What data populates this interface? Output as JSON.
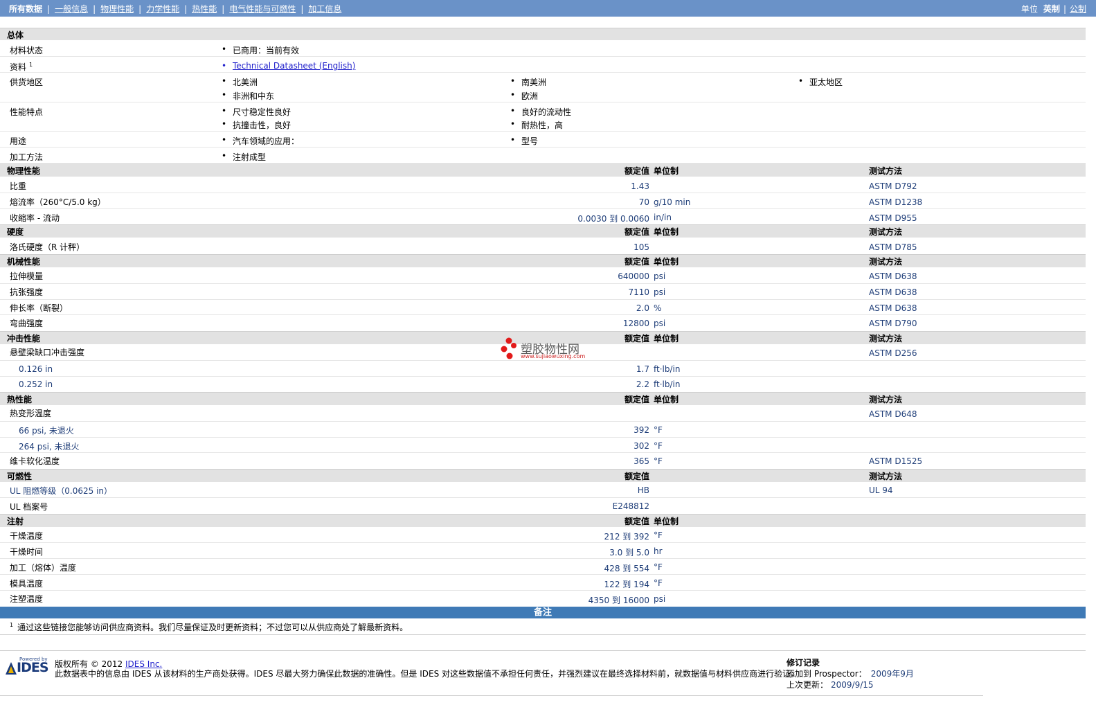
{
  "topnav": {
    "items": [
      "所有数据",
      "一般信息",
      "物理性能",
      "力学性能",
      "热性能",
      "电气性能与可燃性",
      "加工信息"
    ]
  },
  "units": {
    "label": "单位",
    "english": "英制",
    "metric": "公制"
  },
  "general": {
    "title": "总体",
    "status_label": "材料状态",
    "status_value": "已商用：当前有效",
    "doc_label": "资料",
    "doc_sup": "1",
    "doc_link": "Technical Datasheet (English)",
    "region_label": "供货地区",
    "regions": [
      "北美洲",
      "南美洲",
      "亚太地区",
      "非洲和中东",
      "欧洲"
    ],
    "features_label": "性能特点",
    "features": [
      "尺寸稳定性良好",
      "良好的流动性",
      "抗撞击性，良好",
      "耐热性，高"
    ],
    "uses_label": "用途",
    "uses": [
      "汽车领域的应用：",
      "型号"
    ],
    "process_label": "加工方法",
    "process": [
      "注射成型"
    ]
  },
  "headers": {
    "nominal": "额定值",
    "unit": "单位制",
    "method": "测试方法"
  },
  "sections": {
    "physical": "物理性能",
    "hardness": "硬度",
    "mechanical": "机械性能",
    "impact": "冲击性能",
    "thermal": "热性能",
    "flammability": "可燃性",
    "injection": "注射"
  },
  "physical": [
    {
      "label": "比重",
      "value": "1.43",
      "unit": "",
      "method": "ASTM D792"
    },
    {
      "label": "熔流率（260°C/5.0 kg）",
      "value": "70",
      "unit": "g/10 min",
      "method": "ASTM D1238"
    },
    {
      "label": "收缩率 - 流动",
      "value": "0.0030 到  0.0060",
      "unit": "in/in",
      "method": "ASTM D955"
    }
  ],
  "hardness": [
    {
      "label": "洛氏硬度（R 计秤）",
      "value": "105",
      "unit": "",
      "method": "ASTM D785"
    }
  ],
  "mechanical": [
    {
      "label": "拉伸模量",
      "value": "640000",
      "unit": "psi",
      "method": "ASTM D638"
    },
    {
      "label": "抗张强度",
      "value": "7110",
      "unit": "psi",
      "method": "ASTM D638"
    },
    {
      "label": "伸长率（断裂）",
      "value": "2.0",
      "unit": "%",
      "method": "ASTM D638"
    },
    {
      "label": "弯曲强度",
      "value": "12800",
      "unit": "psi",
      "method": "ASTM D790"
    }
  ],
  "impact": {
    "label": "悬壁梁缺口冲击强度",
    "method": "ASTM D256",
    "rows": [
      {
        "label": "0.126 in",
        "value": "1.7",
        "unit": "ft·lb/in"
      },
      {
        "label": "0.252 in",
        "value": "2.2",
        "unit": "ft·lb/in"
      }
    ]
  },
  "thermal": {
    "hdt_label": "热变形温度",
    "hdt_method": "ASTM D648",
    "hdt_rows": [
      {
        "label": "66 psi, 未退火",
        "value": "392",
        "unit": "°F"
      },
      {
        "label": "264 psi, 未退火",
        "value": "302",
        "unit": "°F"
      }
    ],
    "vicat": {
      "label": "维卡软化温度",
      "value": "365",
      "unit": "°F",
      "method": "ASTM D1525"
    }
  },
  "flammability": [
    {
      "label": "UL 阻燃等级（0.0625 in）",
      "value": "HB",
      "method": "UL 94"
    },
    {
      "label": "UL 档案号",
      "value": "E248812",
      "method": ""
    }
  ],
  "injection": [
    {
      "label": "干燥温度",
      "value": "212 到  392",
      "unit": "°F"
    },
    {
      "label": "干燥时间",
      "value": "3.0 到  5.0",
      "unit": "hr"
    },
    {
      "label": "加工（熔体）温度",
      "value": "428 到  554",
      "unit": "°F"
    },
    {
      "label": "模具温度",
      "value": "122 到  194",
      "unit": "°F"
    },
    {
      "label": "注塑温度",
      "value": "4350 到  16000",
      "unit": "psi"
    }
  ],
  "notes": {
    "title": "备注",
    "sup": "1",
    "text": "通过这些链接您能够访问供应商资料。我们尽量保证及时更新资料；不过您可以从供应商处了解最新资料。"
  },
  "watermark": {
    "title": "塑胶物性网",
    "url": "www.sujiaowuxing.com"
  },
  "footer": {
    "powered": "Powered by",
    "logo": "IDES",
    "copyright_prefix": "版权所有 © 2012 ",
    "copyright_link": "IDES Inc.",
    "disclaimer": "此数据表中的信息由 IDES 从该材料的生产商处获得。IDES 尽最大努力确保此数据的准确性。但是 IDES 对这些数据值不承担任何责任，并强烈建议在最终选择材料前，就数据值与材料供应商进行验证。",
    "revision_title": "修订记录",
    "added_label": "添加到 Prospector：",
    "added_value": "2009年9月",
    "updated_label": "上次更新：",
    "updated_value": "2009/9/15"
  }
}
